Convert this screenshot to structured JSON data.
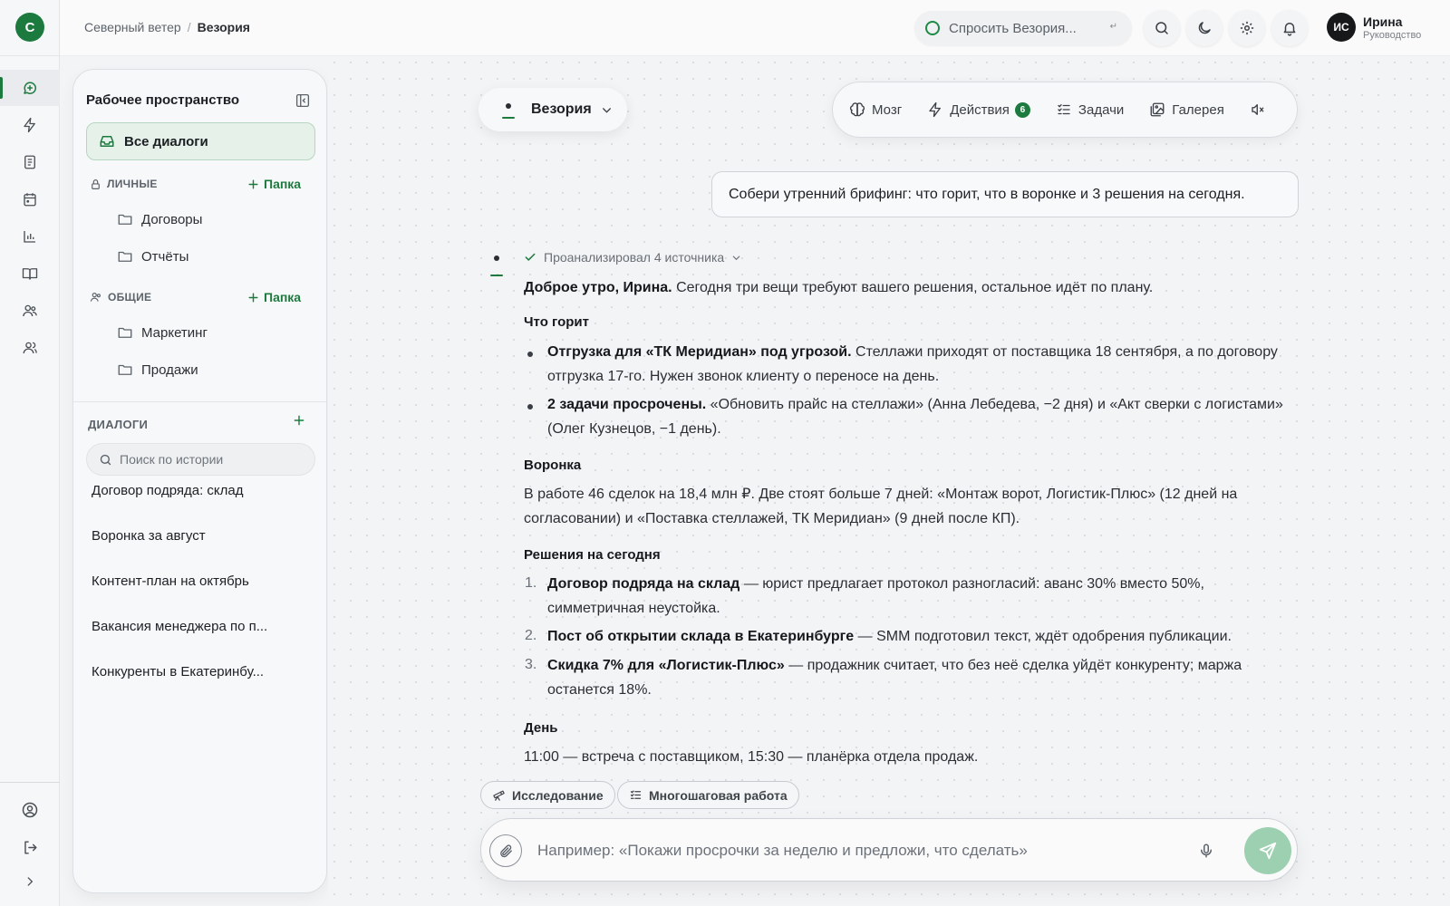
{
  "app": {
    "logo_letter": "С",
    "accent": "#1d7a3e"
  },
  "breadcrumb": {
    "org": "Северный ветер",
    "sep": "/",
    "current": "Везория"
  },
  "topbar": {
    "ask_placeholder": "Спросить Везория...",
    "ask_kbd": "↵"
  },
  "user": {
    "initials": "ИС",
    "name": "Ирина",
    "role": "Руководство"
  },
  "rail": {
    "items": [
      "chat-icon",
      "bolt-icon",
      "document-icon",
      "calendar-icon",
      "chart-icon",
      "book-icon",
      "team-icon",
      "users-icon"
    ],
    "bottom": [
      "account-icon",
      "logout-icon",
      "chevron-right-icon"
    ]
  },
  "workspace": {
    "title": "Рабочее пространство",
    "all_dialogs": "Все диалоги",
    "personal": {
      "label": "ЛИЧНЫЕ",
      "add": "Папка",
      "folders": [
        "Договоры",
        "Отчёты"
      ]
    },
    "shared": {
      "label": "ОБЩИЕ",
      "add": "Папка",
      "folders": [
        "Маркетинг",
        "Продажи"
      ]
    },
    "dialogs_label": "ДИАЛОГИ",
    "search_placeholder": "Поиск по истории",
    "history": [
      "Договор подряда: склад",
      "Воронка за август",
      "Контент-план на октябрь",
      "Вакансия менеджера по п...",
      "Конкуренты в Екатеринбу..."
    ]
  },
  "agent": {
    "name": "Везория"
  },
  "tabs": {
    "brain": "Мозг",
    "actions": "Действия",
    "actions_count": "6",
    "tasks": "Задачи",
    "gallery": "Галерея"
  },
  "chat": {
    "user_message": "Собери утренний брифинг: что горит, что в воронке и 3 решения на сегодня.",
    "analyzed": "Проанализировал 4 источника",
    "greeting_bold": "Доброе утро, Ирина.",
    "greeting_rest": " Сегодня три вещи требуют вашего решения, остальное идёт по плану.",
    "h_fire": "Что горит",
    "fire_1_bold": "Отгрузка для «ТК Меридиан» под угрозой.",
    "fire_1_rest": " Стеллажи приходят от поставщика 18 сентября, а по договору отгрузка 17-го. Нужен звонок клиенту о переносе на день.",
    "fire_2_bold": "2 задачи просрочены.",
    "fire_2_rest": " «Обновить прайс на стеллажи» (Анна Лебедева, −2 дня) и «Акт сверки с логистами» (Олег Кузнецов, −1 день).",
    "h_funnel": "Воронка",
    "funnel_text": "В работе 46 сделок на 18,4 млн ₽. Две стоят больше 7 дней: «Монтаж ворот, Логистик-Плюс» (12 дней на согласовании) и «Поставка стеллажей, ТК Меридиан» (9 дней после КП).",
    "h_decisions": "Решения на сегодня",
    "dec_1_num": "1.",
    "dec_1_bold": "Договор подряда на склад",
    "dec_1_rest": " — юрист предлагает протокол разногласий: аванс 30% вместо 50%, симметричная неустойка.",
    "dec_2_num": "2.",
    "dec_2_bold": "Пост об открытии склада в Екатеринбурге",
    "dec_2_rest": " — SMM подготовил текст, ждёт одобрения публикации.",
    "dec_3_num": "3.",
    "dec_3_bold": "Скидка 7% для «Логистик-Плюс»",
    "dec_3_rest": " — продажник считает, что без неё сделка уйдёт конкуренту; маржа останется 18%.",
    "h_day": "День",
    "day_text": "11:00 — встреча с поставщиком, 15:30 — планёрка отдела продаж."
  },
  "composer": {
    "chip_research": "Исследование",
    "chip_multistep": "Многошаговая работа",
    "placeholder": "Например: «Покажи просрочки за неделю и предложи, что сделать»"
  }
}
